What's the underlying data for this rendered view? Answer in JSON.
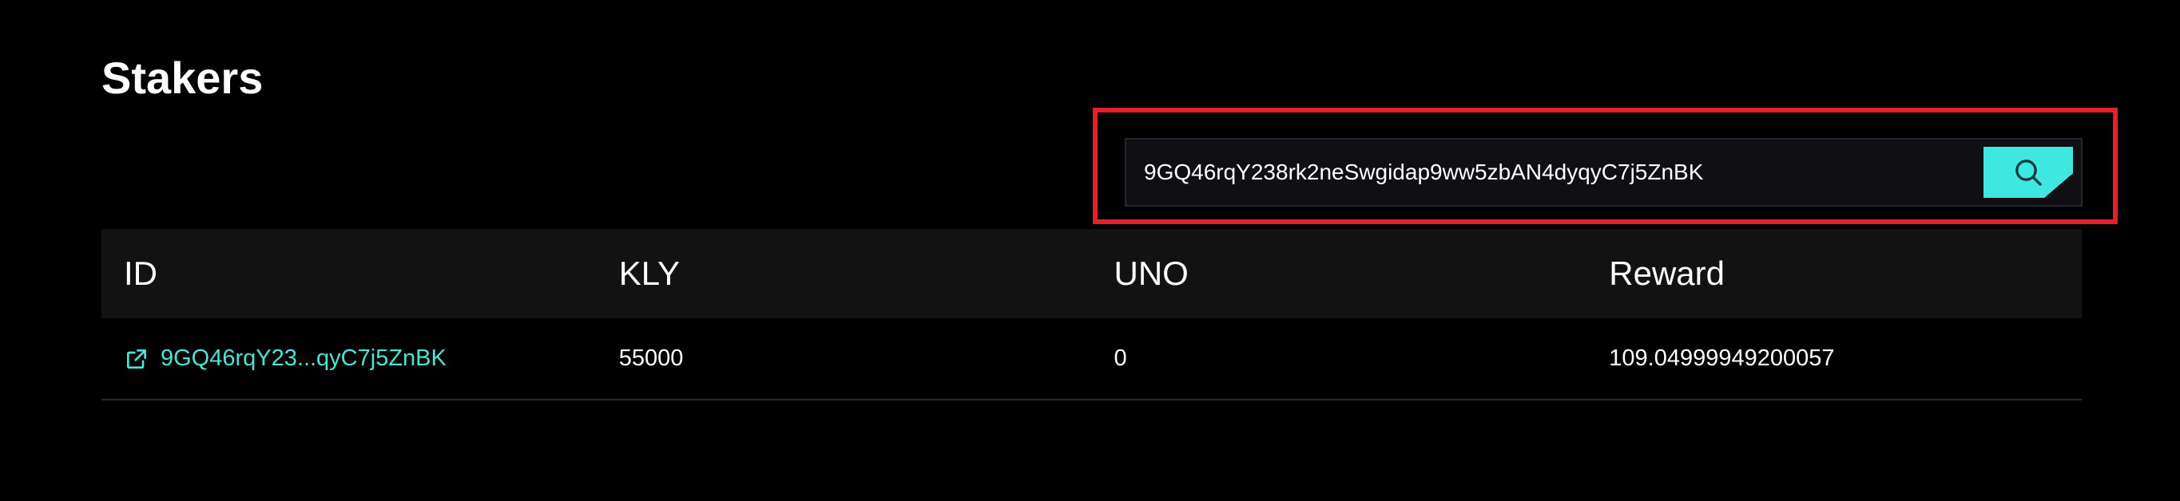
{
  "page": {
    "title": "Stakers"
  },
  "search": {
    "value": "9GQ46rqY238rk2neSwgidap9ww5zbAN4dyqyC7j5ZnBK",
    "button_icon": "search-icon"
  },
  "table": {
    "headers": [
      "ID",
      "KLY",
      "UNO",
      "Reward"
    ],
    "rows": [
      {
        "id": "9GQ46rqY23...qyC7j5ZnBK",
        "id_icon": "external-link-icon",
        "kly": "55000",
        "uno": "0",
        "reward": "109.04999949200057"
      }
    ]
  },
  "colors": {
    "accent": "#3ee8e0",
    "link": "#4fe3d6",
    "highlight": "#e3202e",
    "header_bg": "#121212"
  }
}
